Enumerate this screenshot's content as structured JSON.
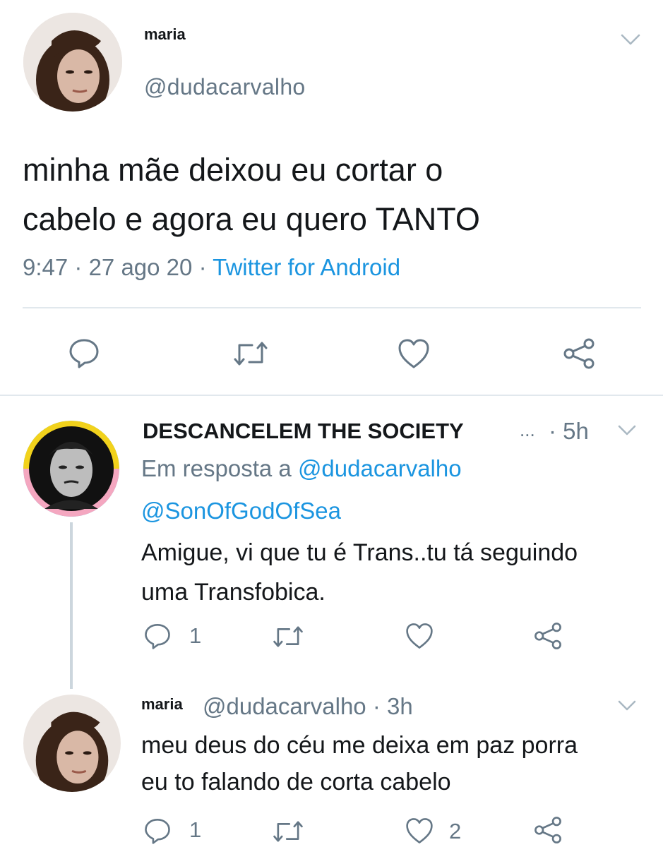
{
  "main_tweet": {
    "display_name": "maria",
    "handle": "@dudacarvalho",
    "text_line1": "minha mãe deixou eu cortar o",
    "text_line2": "cabelo e agora eu quero TANTO",
    "time": "9:47",
    "date": "27 ago 20",
    "source": "Twitter for Android",
    "separator": "·"
  },
  "reply1": {
    "display_name": "DESCANCELEM THE SOCIETY",
    "ellipsis": "...",
    "time": "· 5h",
    "reply_prefix": "Em resposta a",
    "reply_to_1": "@dudacarvalho",
    "reply_to_2": "@SonOfGodOfSea",
    "text_line1": "Amigue, vi que tu é Trans..tu tá seguindo",
    "text_line2": "uma Transfobica.",
    "reply_count": "1",
    "like_count": ""
  },
  "reply2": {
    "display_name": "maria",
    "handle_time": "@dudacarvalho · 3h",
    "text_line1": "meu deus do céu me deixa em paz porra",
    "text_line2": "eu to falando de corta cabelo",
    "reply_count": "1",
    "like_count": "2"
  },
  "icons": {
    "reply": "reply-icon",
    "retweet": "retweet-icon",
    "like": "heart-icon",
    "share": "share-icon",
    "caret": "chevron-down-icon"
  },
  "colors": {
    "text": "#14171a",
    "muted": "#657786",
    "link": "#1b95e0",
    "icon": "#657786",
    "divider": "#e1e8ed"
  }
}
